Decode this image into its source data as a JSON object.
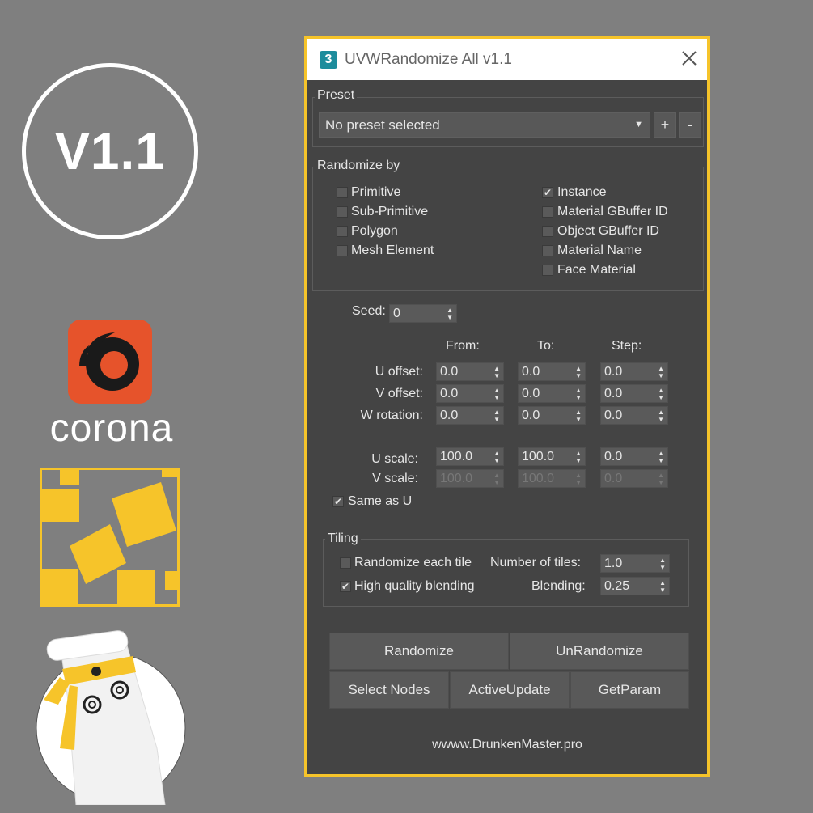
{
  "branding": {
    "version": "V1.1",
    "corona_word": "corona",
    "colors": {
      "accent": "#f6c42a",
      "corona_orange": "#e6532b"
    }
  },
  "dialog": {
    "title": "UVWRandomize All v1.1",
    "app_icon_label": "3",
    "preset": {
      "label": "Preset",
      "selected": "No preset selected",
      "add_label": "+",
      "remove_label": "-"
    },
    "randomize_by": {
      "label": "Randomize by",
      "left_options": [
        {
          "label": "Primitive",
          "checked": false
        },
        {
          "label": "Sub-Primitive",
          "checked": false
        },
        {
          "label": "Polygon",
          "checked": false
        },
        {
          "label": "Mesh Element",
          "checked": false
        }
      ],
      "right_options": [
        {
          "label": "Instance",
          "checked": true
        },
        {
          "label": "Material GBuffer ID",
          "checked": false
        },
        {
          "label": "Object GBuffer ID",
          "checked": false
        },
        {
          "label": "Material Name",
          "checked": false
        },
        {
          "label": "Face Material",
          "checked": false
        }
      ]
    },
    "seed": {
      "label": "Seed:",
      "value": "0"
    },
    "columns": {
      "from": "From:",
      "to": "To:",
      "step": "Step:"
    },
    "rows": [
      {
        "label": "U offset:",
        "from": "0.0",
        "to": "0.0",
        "step": "0.0",
        "enabled": true
      },
      {
        "label": "V offset:",
        "from": "0.0",
        "to": "0.0",
        "step": "0.0",
        "enabled": true
      },
      {
        "label": "W rotation:",
        "from": "0.0",
        "to": "0.0",
        "step": "0.0",
        "enabled": true
      },
      {
        "label": "U scale:",
        "from": "100.0",
        "to": "100.0",
        "step": "0.0",
        "enabled": true
      },
      {
        "label": "V scale:",
        "from": "100.0",
        "to": "100.0",
        "step": "0.0",
        "enabled": false
      }
    ],
    "same_as_u": {
      "label": "Same as U",
      "checked": true
    },
    "tiling": {
      "label": "Tiling",
      "randomize_each_tile": {
        "label": "Randomize each tile",
        "checked": false
      },
      "high_quality_blending": {
        "label": "High quality blending",
        "checked": true
      },
      "number_of_tiles": {
        "label": "Number of tiles:",
        "value": "1.0"
      },
      "blending": {
        "label": "Blending:",
        "value": "0.25"
      }
    },
    "buttons": {
      "randomize": "Randomize",
      "unrandomize": "UnRandomize",
      "select_nodes": "Select Nodes",
      "active_update": "ActiveUpdate",
      "get_param": "GetParam"
    },
    "footer": "wwww.DrunkenMaster.pro"
  }
}
